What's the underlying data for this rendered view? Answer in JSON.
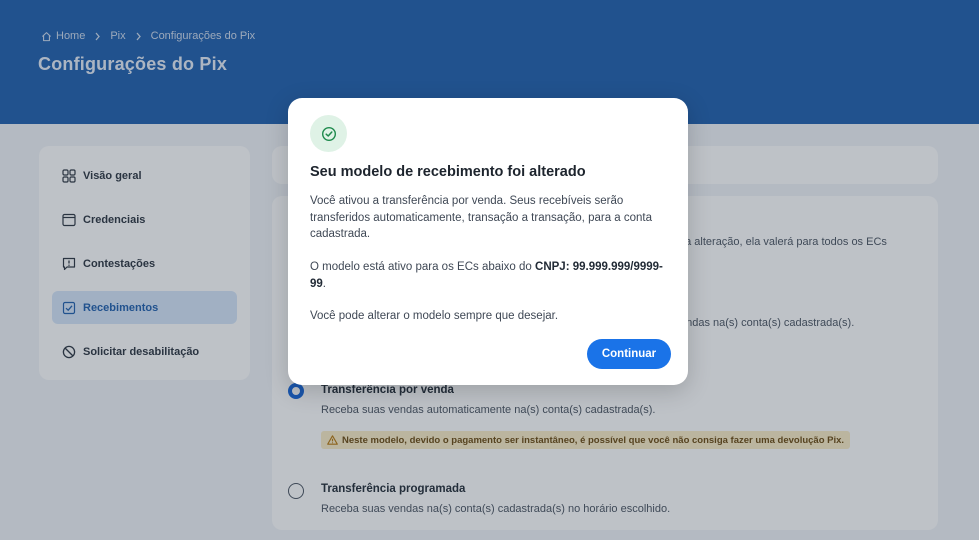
{
  "breadcrumb": {
    "home": "Home",
    "pix": "Pix",
    "current": "Configurações do Pix"
  },
  "page": {
    "title": "Configurações do Pix"
  },
  "sidebar": {
    "items": [
      {
        "label": "Visão geral",
        "icon": "grid-icon"
      },
      {
        "label": "Credenciais",
        "icon": "window-icon"
      },
      {
        "label": "Contestações",
        "icon": "alert-box-icon"
      },
      {
        "label": "Recebimentos",
        "icon": "checkbox-icon",
        "active": true
      },
      {
        "label": "Solicitar desabilitação",
        "icon": "ban-icon"
      }
    ]
  },
  "main": {
    "partial_line_1": "na alteração, ela valerá para todos os ECs",
    "partial_line_2": "endas na(s) conta(s) cadastrada(s).",
    "options": [
      {
        "title": "Transferência por venda",
        "description": "Receba suas vendas automaticamente na(s) conta(s) cadastrada(s).",
        "selected": true
      },
      {
        "title": "Transferência programada",
        "description": "Receba suas vendas na(s) conta(s) cadastrada(s) no horário escolhido.",
        "selected": false
      }
    ],
    "warning": "Neste modelo, devido o pagamento ser instantâneo, é possível que você não consiga fazer uma devolução Pix."
  },
  "modal": {
    "title": "Seu modelo de recebimento foi alterado",
    "paragraph1": "Você ativou a transferência por venda. Seus recebíveis serão transferidos automaticamente, transação a transação, para a conta cadastrada.",
    "paragraph2_prefix": "O modelo está ativo para os ECs abaixo do ",
    "paragraph2_bold": "CNPJ: 99.999.999/9999-99",
    "paragraph2_suffix": ".",
    "paragraph3": "Você pode alterar o modelo sempre que desejar.",
    "button": "Continuar"
  },
  "colors": {
    "header": "#1f5fae",
    "accent": "#1a73e8",
    "success": "#1e8a4c",
    "warning_bg": "#fbecc6"
  }
}
